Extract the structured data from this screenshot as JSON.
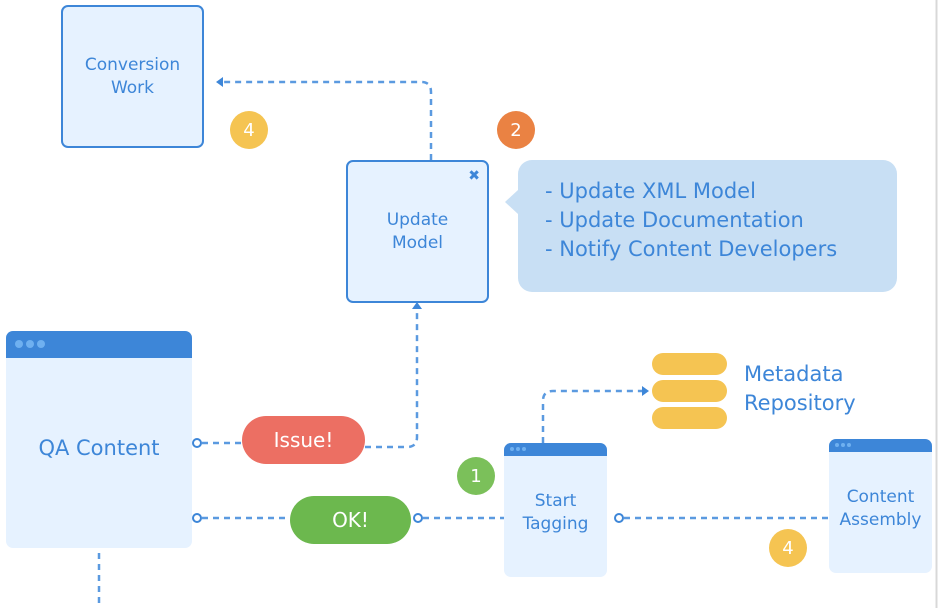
{
  "colors": {
    "primary": "#3d86d8",
    "box_fill": "#e6f2ff",
    "callout_fill": "#c8dff4",
    "issue": "#ec6f63",
    "ok": "#6cb84e",
    "badge_yellow": "#f5c452",
    "badge_orange": "#ea8243",
    "badge_green": "#7bc05a"
  },
  "nodes": {
    "conversion_work": {
      "line1": "Conversion",
      "line2": "Work"
    },
    "update_model": {
      "line1": "Update",
      "line2": "Model",
      "close_icon": "close-icon"
    },
    "qa_content": {
      "label": "QA Content"
    },
    "start_tagging": {
      "line1": "Start",
      "line2": "Tagging"
    },
    "content_assembly": {
      "line1": "Content",
      "line2": "Assembly"
    },
    "metadata_repository": {
      "line1": "Metadata",
      "line2": "Repository",
      "icon": "database-icon"
    }
  },
  "callout": {
    "items": [
      "- Update XML Model",
      "- Update Documentation",
      "- Notify Content Developers"
    ]
  },
  "pills": {
    "issue": "Issue!",
    "ok": "OK!"
  },
  "badges": {
    "conversion": "4",
    "update": "2",
    "tagging": "1",
    "assembly": "4"
  }
}
